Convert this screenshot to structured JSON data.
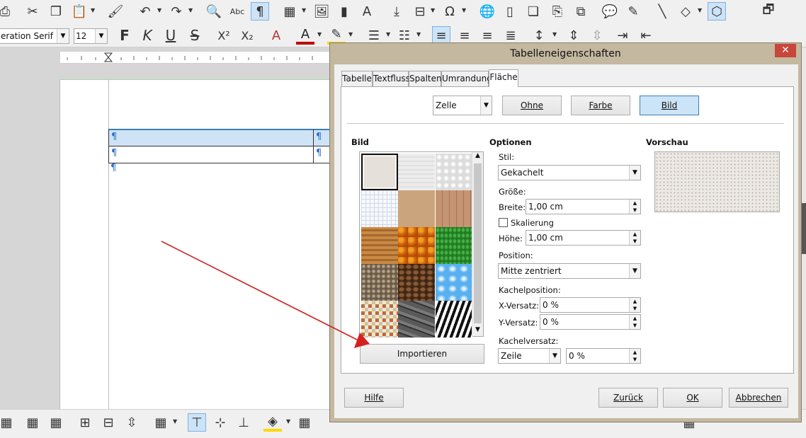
{
  "toolbar": {
    "font_name": "eration Serif",
    "font_size": "12",
    "bold_label": "F",
    "italic_label": "K",
    "underline_label": "U",
    "strike_label": "S",
    "superscript_label": "X²",
    "subscript_label": "X₂",
    "icons": [
      "print-preview-icon",
      "cut-icon",
      "copy-icon",
      "paste-icon",
      "clone-formatting-icon",
      "undo-icon",
      "redo-icon",
      "find-replace-icon",
      "spelling-icon",
      "formatting-marks-icon",
      "table-icon",
      "image-icon",
      "chart-icon",
      "textbox-icon",
      "page-break-icon",
      "field-icon",
      "special-character-icon",
      "hyperlink-icon",
      "footnote-icon",
      "endnote-icon",
      "bookmark-icon",
      "cross-reference-icon",
      "comment-icon",
      "track-changes-icon",
      "line-icon",
      "shapes-icon",
      "draw-functions-icon"
    ]
  },
  "document": {
    "pilcrow": "¶"
  },
  "dialog": {
    "title": "Tabelleneigenschaften",
    "close_label": "✕",
    "tabs": [
      "Tabelle",
      "Textfluss",
      "Spalten",
      "Umrandung",
      "Fläche"
    ],
    "selected_tab": "Fläche",
    "target_select": "Zelle",
    "fill_buttons": {
      "none": "Ohne",
      "color": "Farbe",
      "bitmap": "Bild"
    },
    "bitmap_section_label": "Bild",
    "import_button": "Importieren",
    "options": {
      "heading": "Optionen",
      "style_label": "Stil:",
      "style_value": "Gekachelt",
      "size_label": "Größe:",
      "width_label": "Breite:",
      "width_value": "1,00 cm",
      "scale_label": "Skalierung",
      "height_label": "Höhe:",
      "height_value": "1,00 cm",
      "position_label": "Position:",
      "position_value": "Mitte zentriert",
      "tile_position_label": "Kachelposition:",
      "x_offset_label": "X-Versatz:",
      "x_offset_value": "0 %",
      "y_offset_label": "Y-Versatz:",
      "y_offset_value": "0 %",
      "tile_offset_label": "Kachelversatz:",
      "tile_offset_select": "Zeile",
      "tile_offset_value": "0 %"
    },
    "preview_label": "Vorschau",
    "footer": {
      "help": "Hilfe",
      "reset": "Zurück",
      "ok": "OK",
      "cancel": "Abbrechen"
    }
  },
  "colors": {
    "accent_selected": "#cce4f7",
    "dialog_frame": "#c4b8a0",
    "close_button": "#c8463a",
    "annotation_arrow": "#d42020"
  }
}
